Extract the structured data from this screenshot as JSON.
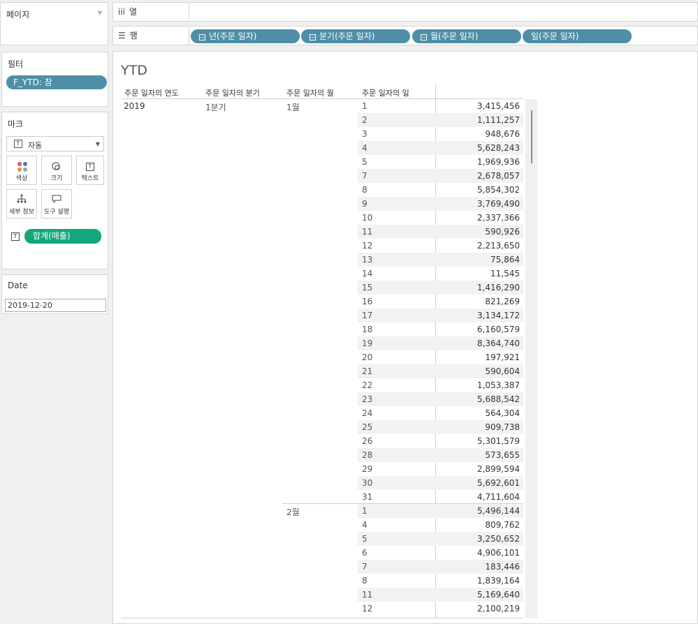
{
  "pages": {
    "title": "페이지"
  },
  "filters": {
    "title": "필터",
    "pill": "F_YTD: 참"
  },
  "marks": {
    "title": "마크",
    "type_label": "자동",
    "buttons": {
      "color": "색상",
      "size": "크기",
      "text": "텍스트",
      "detail": "세부 정보",
      "tooltip": "도구 설명"
    },
    "measure_pill": "합계(매출)"
  },
  "date_param": {
    "title": "Date",
    "value": "2019-12-20"
  },
  "shelves": {
    "columns_label": "열",
    "rows_label": "행",
    "rows_pills": [
      "년(주문 일자)",
      "분기(주문 일자)",
      "월(주문 일자)",
      "일(주문 일자)"
    ]
  },
  "view": {
    "title": "YTD",
    "headers": [
      "주문 일자의 연도",
      "주문 일자의 분기",
      "주문 일자의 월",
      "주문 일자의 일"
    ],
    "year": "2019",
    "quarter": "1분기",
    "months": [
      {
        "label": "1월",
        "rows": [
          [
            "1",
            "3,415,456"
          ],
          [
            "2",
            "1,111,257"
          ],
          [
            "3",
            "948,676"
          ],
          [
            "4",
            "5,628,243"
          ],
          [
            "5",
            "1,969,936"
          ],
          [
            "7",
            "2,678,057"
          ],
          [
            "8",
            "5,854,302"
          ],
          [
            "9",
            "3,769,490"
          ],
          [
            "10",
            "2,337,366"
          ],
          [
            "11",
            "590,926"
          ],
          [
            "12",
            "2,213,650"
          ],
          [
            "13",
            "75,864"
          ],
          [
            "14",
            "11,545"
          ],
          [
            "15",
            "1,416,290"
          ],
          [
            "16",
            "821,269"
          ],
          [
            "17",
            "3,134,172"
          ],
          [
            "18",
            "6,160,579"
          ],
          [
            "19",
            "8,364,740"
          ],
          [
            "20",
            "197,921"
          ],
          [
            "21",
            "590,604"
          ],
          [
            "22",
            "1,053,387"
          ],
          [
            "23",
            "5,688,542"
          ],
          [
            "24",
            "564,304"
          ],
          [
            "25",
            "909,738"
          ],
          [
            "26",
            "5,301,579"
          ],
          [
            "28",
            "573,655"
          ],
          [
            "29",
            "2,899,594"
          ],
          [
            "30",
            "5,692,601"
          ],
          [
            "31",
            "4,711,604"
          ]
        ]
      },
      {
        "label": "2월",
        "rows": [
          [
            "1",
            "5,496,144"
          ],
          [
            "4",
            "809,762"
          ],
          [
            "5",
            "3,250,652"
          ],
          [
            "6",
            "4,906,101"
          ],
          [
            "7",
            "183,446"
          ],
          [
            "8",
            "1,839,164"
          ],
          [
            "11",
            "5,169,640"
          ],
          [
            "12",
            "2,100,219"
          ]
        ]
      }
    ]
  },
  "colors": {
    "dimension_pill": "#4e8fa7",
    "measure_pill": "#12a77c",
    "color_dots": [
      "#e15759",
      "#4e79a7",
      "#f28e2b",
      "#76b7b2"
    ]
  }
}
